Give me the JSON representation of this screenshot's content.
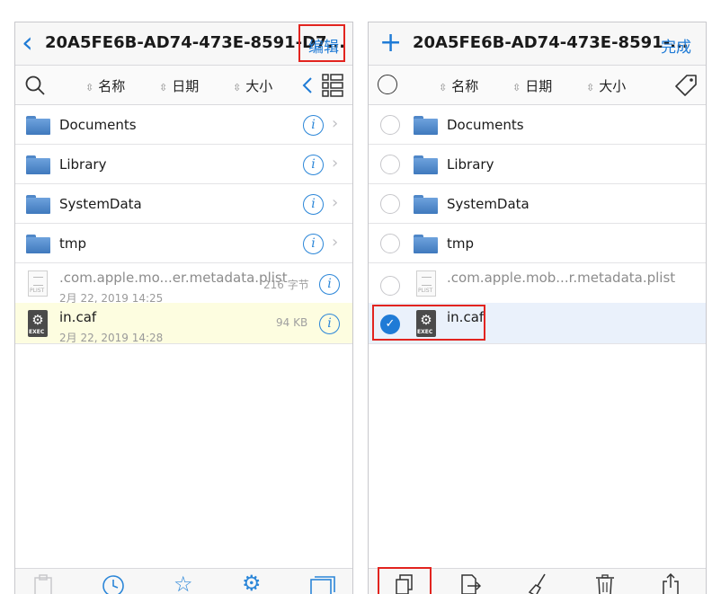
{
  "left": {
    "back_glyph": "‹",
    "title": "20A5FE6B-AD74-473E-8591-D7...",
    "edit_label": "编辑",
    "sort": {
      "name": "名称",
      "date": "日期",
      "size": "大小"
    },
    "rows": [
      {
        "name": "Documents"
      },
      {
        "name": "Library"
      },
      {
        "name": "SystemData"
      },
      {
        "name": "tmp"
      },
      {
        "name": ".com.apple.mo...er.metadata.plist",
        "date": "2月 22, 2019 14:25",
        "size": "216 字节"
      },
      {
        "name": "in.caf",
        "date": "2月 22, 2019 14:28",
        "size": "94 KB"
      }
    ]
  },
  "right": {
    "plus_glyph": "+",
    "title": "20A5FE6B-AD74-473E-8591-...",
    "done_label": "完成",
    "sort": {
      "name": "名称",
      "date": "日期",
      "size": "大小"
    },
    "rows": [
      {
        "name": "Documents"
      },
      {
        "name": "Library"
      },
      {
        "name": "SystemData"
      },
      {
        "name": "tmp"
      },
      {
        "name": ".com.apple.mob...r.metadata.plist"
      },
      {
        "name": "in.caf"
      }
    ]
  },
  "icons": {
    "info": "i",
    "chevron": "›",
    "check": "✓",
    "plist_tag": "PLIST",
    "exec_tag": "EXEC"
  },
  "colors": {
    "accent": "#1f7bd6",
    "highlight_red": "#e2241f",
    "selected_row_left": "#fdfde0",
    "selected_row_right": "#eaf1fb"
  }
}
